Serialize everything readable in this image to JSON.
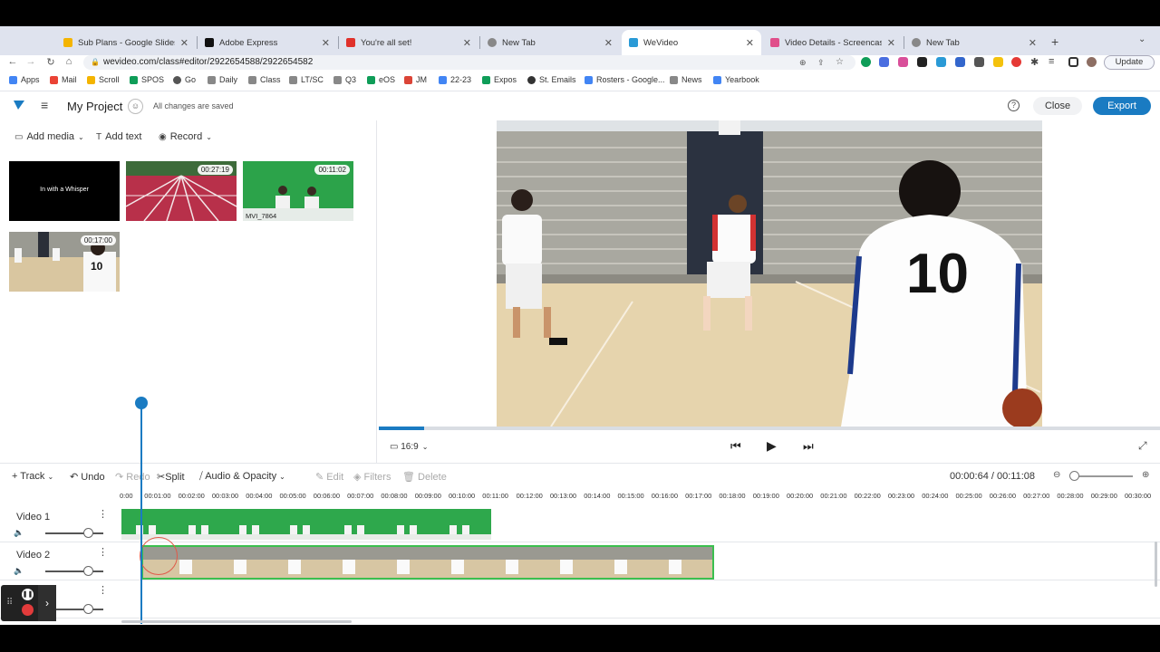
{
  "browser": {
    "tabs": [
      {
        "label": "Sub Plans - Google Slides",
        "favicon_color": "#f4b400"
      },
      {
        "label": "Adobe Express",
        "favicon_color": "#111111"
      },
      {
        "label": "You're all set!",
        "favicon_color": "#e0312b"
      },
      {
        "label": "New Tab",
        "favicon_color": "#777777"
      },
      {
        "label": "WeVideo",
        "favicon_color": "#2a9ad6",
        "active": true
      },
      {
        "label": "Video Details - Screencastify",
        "favicon_color": "#e04e8a"
      },
      {
        "label": "New Tab",
        "favicon_color": "#777777"
      }
    ],
    "url": "wevideo.com/class#editor/2922654588/2922654582",
    "update_label": "Update",
    "bookmarks": [
      {
        "label": "Apps",
        "color": "#4285f4"
      },
      {
        "label": "Mail",
        "color": "#ea4335"
      },
      {
        "label": "Scroll",
        "color": "#f4b400"
      },
      {
        "label": "SPOS",
        "color": "#0f9d58"
      },
      {
        "label": "Go",
        "color": "#555555"
      },
      {
        "label": "Daily",
        "color": "#777777"
      },
      {
        "label": "Class",
        "color": "#777777"
      },
      {
        "label": "LT/SC",
        "color": "#777777"
      },
      {
        "label": "Q3",
        "color": "#777777"
      },
      {
        "label": "eOS",
        "color": "#0f9d58"
      },
      {
        "label": "JM",
        "color": "#db4437"
      },
      {
        "label": "22-23",
        "color": "#4285f4"
      },
      {
        "label": "Expos",
        "color": "#0f9d58"
      },
      {
        "label": "St. Emails",
        "color": "#333333"
      },
      {
        "label": "Rosters - Google...",
        "color": "#4285f4"
      },
      {
        "label": "News",
        "color": "#777777"
      },
      {
        "label": "Yearbook",
        "color": "#4285f4"
      }
    ]
  },
  "app": {
    "project_title": "My Project",
    "save_status": "All changes are saved",
    "close_label": "Close",
    "export_label": "Export",
    "accent": "#1a7bc2"
  },
  "media": {
    "tools": {
      "add_media": "Add media",
      "add_text": "Add text",
      "record": "Record"
    },
    "items": [
      {
        "title": "In with a Whisper",
        "duration": ""
      },
      {
        "title": "",
        "duration": "00:27:19"
      },
      {
        "title": "MVI_7864",
        "duration": "00:11:02"
      },
      {
        "title": "",
        "duration": "00:17:00"
      }
    ]
  },
  "player": {
    "aspect_label": "16:9",
    "progress_fraction": 0.058
  },
  "timeline": {
    "tools": {
      "track": "Track",
      "undo": "Undo",
      "redo": "Redo",
      "split": "Split",
      "audio_opacity": "Audio & Opacity",
      "edit": "Edit",
      "filters": "Filters",
      "delete": "Delete"
    },
    "current_time": "00:00:64",
    "total_time": "00:11:08",
    "ticks": [
      "0:00",
      "00:01:00",
      "00:02:00",
      "00:03:00",
      "00:04:00",
      "00:05:00",
      "00:06:00",
      "00:07:00",
      "00:08:00",
      "00:09:00",
      "00:10:00",
      "00:11:00",
      "00:12:00",
      "00:13:00",
      "00:14:00",
      "00:15:00",
      "00:16:00",
      "00:17:00",
      "00:18:00",
      "00:19:00",
      "00:20:00",
      "00:21:00",
      "00:22:00",
      "00:23:00",
      "00:24:00",
      "00:25:00",
      "00:26:00",
      "00:27:00",
      "00:28:00",
      "00:29:00",
      "00:30:00"
    ],
    "tracks": [
      {
        "label": "Video 1"
      },
      {
        "label": "Video 2"
      },
      {
        "label": ""
      }
    ]
  }
}
